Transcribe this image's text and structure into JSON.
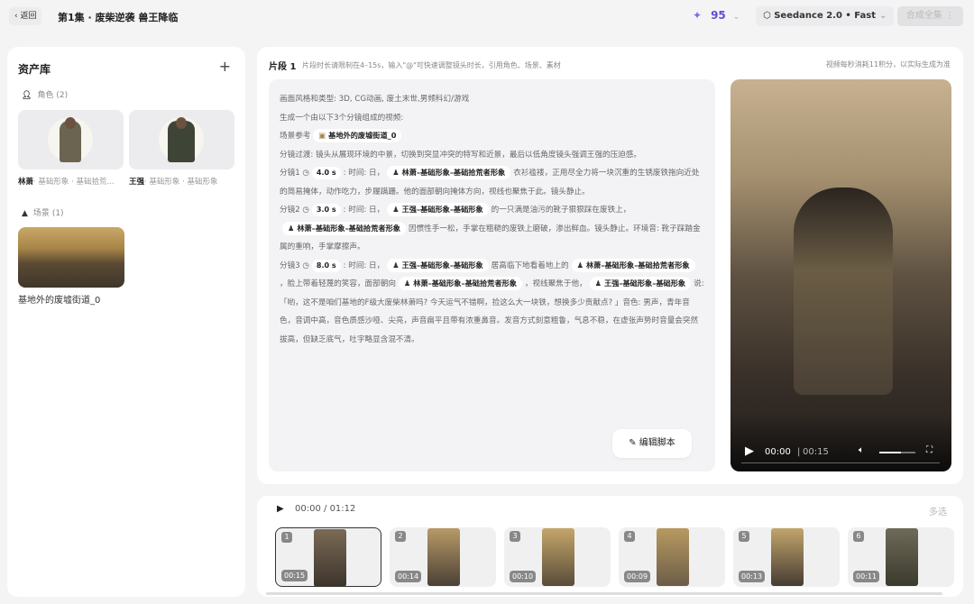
{
  "header": {
    "back_label": "返回",
    "title": "第1集 · 废柴逆袭 兽王降临",
    "credits": "95",
    "model": "Seedance 2.0 • Fast",
    "compose_label": "合成全集"
  },
  "assets": {
    "title": "资产库",
    "characters_label": "角色",
    "characters_count": "(2)",
    "characters": [
      {
        "name": "林萧",
        "desc": "· 基础形象 · 基础拾荒..."
      },
      {
        "name": "王强",
        "desc": "· 基础形象 · 基础形象"
      }
    ],
    "scenes_label": "场景",
    "scenes_count": "(1)",
    "scenes": [
      {
        "name": "基地外的废墟街道_0"
      }
    ]
  },
  "segment": {
    "title": "片段 1",
    "hint": "片段时长请限制在4–15s，输入\"@\"可快速调整镜头时长，引用角色、场景、素材",
    "cost_note": "视频每秒消耗11积分，以实际生成为准",
    "edit_label": "编辑脚本",
    "script": [
      [
        {
          "t": "画面风格和类型: 3D, CG动画, 废土末世,男频科幻/游戏"
        }
      ],
      [
        {
          "t": "生成一个由以下3个分镜组成的视频:"
        }
      ],
      [
        {
          "t": "场景参考"
        },
        {
          "scene": "基地外的废墟街道_0"
        }
      ],
      [
        {
          "t": "分镜过渡: 镜头从展现环境的中景，切换到突显冲突的特写和近景，最后以低角度镜头强调王强的压迫感。"
        }
      ],
      [
        {
          "t": "分镜1 ◷"
        },
        {
          "time": "4.0 s"
        },
        {
          "t": ": 时间: 日，"
        },
        {
          "tag": "林萧–基础形象–基础拾荒者形象"
        },
        {
          "t": "衣衫褴褛，正用尽全力将一块沉重的生锈废铁拖向近处的简易掩体，动作吃力，步履蹒跚。他的面部朝向掩体方向，视线也聚焦于此。镜头静止。"
        }
      ],
      [
        {
          "t": "分镜2 ◷"
        },
        {
          "time": "3.0 s"
        },
        {
          "t": ": 时间: 日，"
        },
        {
          "tag": "王强–基础形象–基础形象"
        },
        {
          "t": "的一只满是油污的靴子狠狠踩在废铁上，"
        },
        {
          "tag": "林萧–基础形象–基础拾荒者形象"
        },
        {
          "t": "因惯性手一松，手掌在粗糙的废铁上磨破，渗出鲜血。镜头静止。环境音: 靴子踩踏金属的重响，手掌摩擦声。"
        }
      ],
      [
        {
          "t": "分镜3 ◷"
        },
        {
          "time": "8.0 s"
        },
        {
          "t": ": 时间: 日，"
        },
        {
          "tag": "王强–基础形象–基础形象"
        },
        {
          "t": "居高临下地看着地上的"
        },
        {
          "tag": "林萧–基础形象–基础拾荒者形象"
        },
        {
          "t": "，脸上带着轻蔑的笑容，面部朝向"
        },
        {
          "tag": "林萧–基础形象–基础拾荒者形象"
        },
        {
          "t": "，视线聚焦于他，"
        },
        {
          "tag": "王强–基础形象–基础形象"
        },
        {
          "t": "说:「哟，这不是咱们基地的F级大废柴林萧吗? 今天运气不错啊，捡这么大一块铁，想换多少贡献点? 」音色: 男声，青年音色，音调中高，音色质感沙哑、尖亮，声音扁平且带有浓重鼻音。发音方式刻意粗鲁，气息不稳，在虚张声势时音量会突然拔高，但缺乏底气，吐字略显含混不清。"
        }
      ]
    ]
  },
  "video": {
    "current": "00:00",
    "duration": "00:15",
    "volume": 0.6
  },
  "timeline": {
    "current": "00:00",
    "total": "01:12",
    "multi_select_label": "多选",
    "clips": [
      {
        "num": "1",
        "dur": "00:15",
        "selected": true
      },
      {
        "num": "2",
        "dur": "00:14"
      },
      {
        "num": "3",
        "dur": "00:10"
      },
      {
        "num": "4",
        "dur": "00:09"
      },
      {
        "num": "5",
        "dur": "00:13"
      },
      {
        "num": "6",
        "dur": "00:11"
      }
    ]
  }
}
